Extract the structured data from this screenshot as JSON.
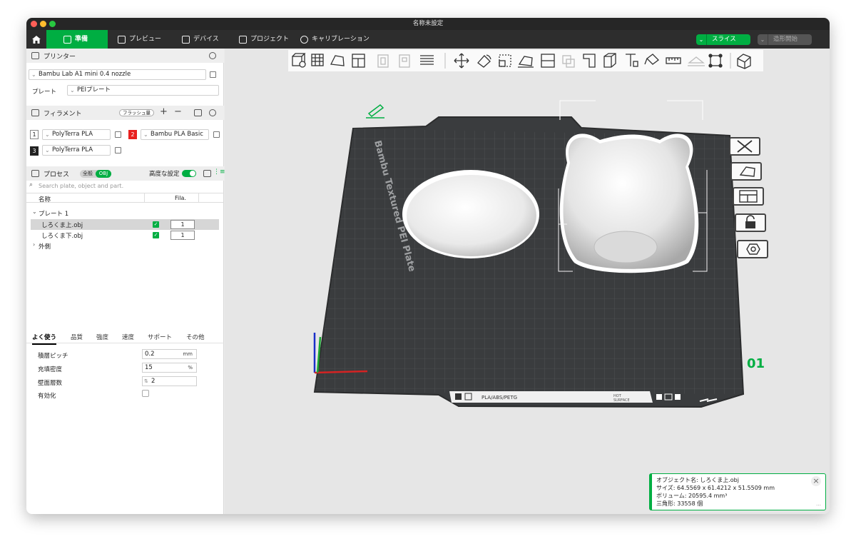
{
  "window": {
    "title": "名称未設定"
  },
  "menubar": {
    "tabs": [
      {
        "label": "準備",
        "icon": "cube-icon",
        "active": true
      },
      {
        "label": "プレビュー",
        "icon": "layers-icon",
        "active": false
      },
      {
        "label": "デバイス",
        "icon": "device-icon",
        "active": false
      },
      {
        "label": "プロジェクト",
        "icon": "project-icon",
        "active": false
      },
      {
        "label": "キャリブレーション",
        "icon": "calibration-icon",
        "active": false
      }
    ],
    "slice_label": "スライス",
    "print_label": "造形開始"
  },
  "printer": {
    "header": "プリンター",
    "model": "Bambu Lab A1 mini 0.4 nozzle",
    "plate_label": "プレート",
    "plate_value": "PEIプレート"
  },
  "filament": {
    "header": "フィラメント",
    "flush_label": "フラッシュ量",
    "items": [
      {
        "index": "1",
        "name": "PolyTerra PLA",
        "color": "#ffffff"
      },
      {
        "index": "2",
        "name": "Bambu PLA Basic",
        "color": "#e8201f"
      },
      {
        "index": "3",
        "name": "PolyTerra PLA",
        "color": "#222222"
      }
    ]
  },
  "process": {
    "header": "プロセス",
    "seg_global": "全般",
    "seg_obj": "OBJ",
    "advanced_label": "高度な設定",
    "search_placeholder": "Search plate, object and part.",
    "col_name": "名称",
    "col_fila": "Fila.",
    "tree": {
      "plate": "プレート 1",
      "objects": [
        {
          "name": "しろくま上.obj",
          "fila": "1",
          "selected": true
        },
        {
          "name": "しろくま下.obj",
          "fila": "1",
          "selected": false
        }
      ],
      "outside": "外側"
    }
  },
  "settings": {
    "tabs": [
      "よく使う",
      "品質",
      "強度",
      "速度",
      "サポート",
      "その他"
    ],
    "layer_height": {
      "label": "積層ピッチ",
      "value": "0.2",
      "unit": "mm"
    },
    "infill": {
      "label": "充填密度",
      "value": "15",
      "unit": "%"
    },
    "walls": {
      "label": "壁面層数",
      "value": "2"
    },
    "enable": {
      "label": "有効化"
    }
  },
  "bed": {
    "label": "Bambu Textured PEI Plate",
    "materials": "PLA/ABS/PETG",
    "hot": "HOT",
    "surface": "SURFACE",
    "plate_number": "01"
  },
  "info": {
    "name": "オブジェクト名: しろくま上.obj",
    "size": "サイズ: 64.5569 x 61.4212 x 51.5509 mm",
    "volume": "ボリューム: 20595.4 mm³",
    "triangles": "三角形: 33558 個"
  },
  "colors": {
    "accent": "#00ae42",
    "bed": "#3a3c3e"
  }
}
